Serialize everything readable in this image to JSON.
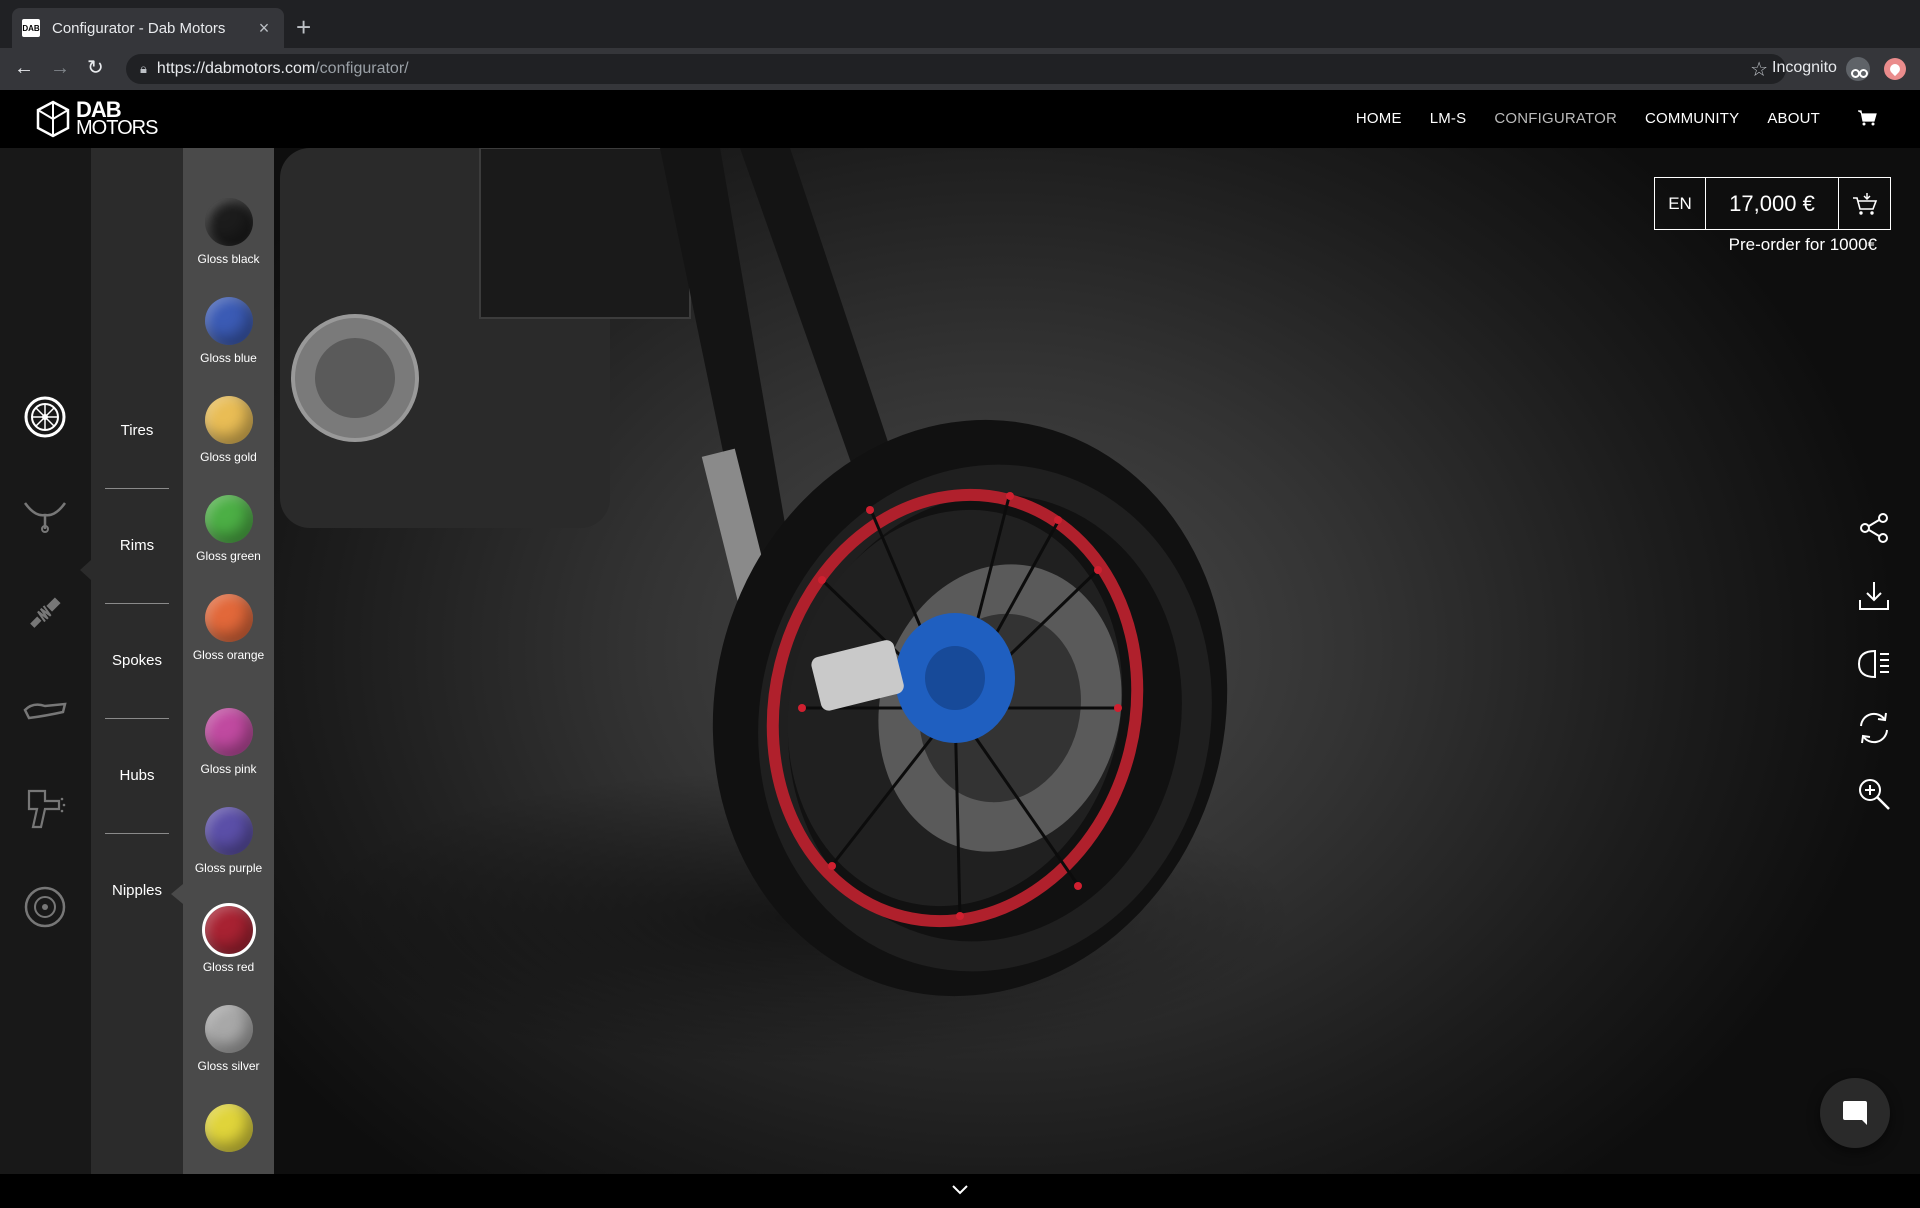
{
  "browser": {
    "tab_title": "Configurator - Dab Motors",
    "favicon_text": "DAB",
    "url_host": "https://dabmotors.com",
    "url_path": "/configurator/",
    "incognito_label": "Incognito"
  },
  "site": {
    "logo_top": "DAB",
    "logo_bottom": "MOTORS",
    "nav": [
      "HOME",
      "LM-S",
      "CONFIGURATOR",
      "COMMUNITY",
      "ABOUT"
    ],
    "active_nav": "CONFIGURATOR"
  },
  "configurator": {
    "rail_icons": [
      "wheel-icon",
      "handlebar-icon",
      "suspension-icon",
      "seat-icon",
      "paint-gun-icon",
      "brake-disc-icon"
    ],
    "active_rail": "wheel-icon",
    "categories": [
      "Tires",
      "Rims",
      "Spokes",
      "Hubs",
      "Nipples"
    ],
    "active_category": "Nipples",
    "colors": [
      {
        "label": "Gloss black",
        "hex": "#1c1c1c"
      },
      {
        "label": "Gloss blue",
        "hex": "#3b5bb5"
      },
      {
        "label": "Gloss gold",
        "hex": "#e9bd55"
      },
      {
        "label": "Gloss green",
        "hex": "#4caf45"
      },
      {
        "label": "Gloss orange",
        "hex": "#e2683a"
      },
      {
        "label": "Gloss pink",
        "hex": "#c04aa0"
      },
      {
        "label": "Gloss purple",
        "hex": "#5b4fa8"
      },
      {
        "label": "Gloss red",
        "hex": "#a82232"
      },
      {
        "label": "Gloss silver",
        "hex": "#a8a8a8"
      },
      {
        "label": "",
        "hex": "#e0d43a"
      }
    ],
    "selected_color": "Gloss red"
  },
  "price": {
    "language": "EN",
    "value": "17,000 €",
    "preorder_text": "Pre-order for 1000€"
  },
  "tools": [
    "share-icon",
    "download-icon",
    "headlight-icon",
    "rotate-icon",
    "zoom-in-icon"
  ]
}
